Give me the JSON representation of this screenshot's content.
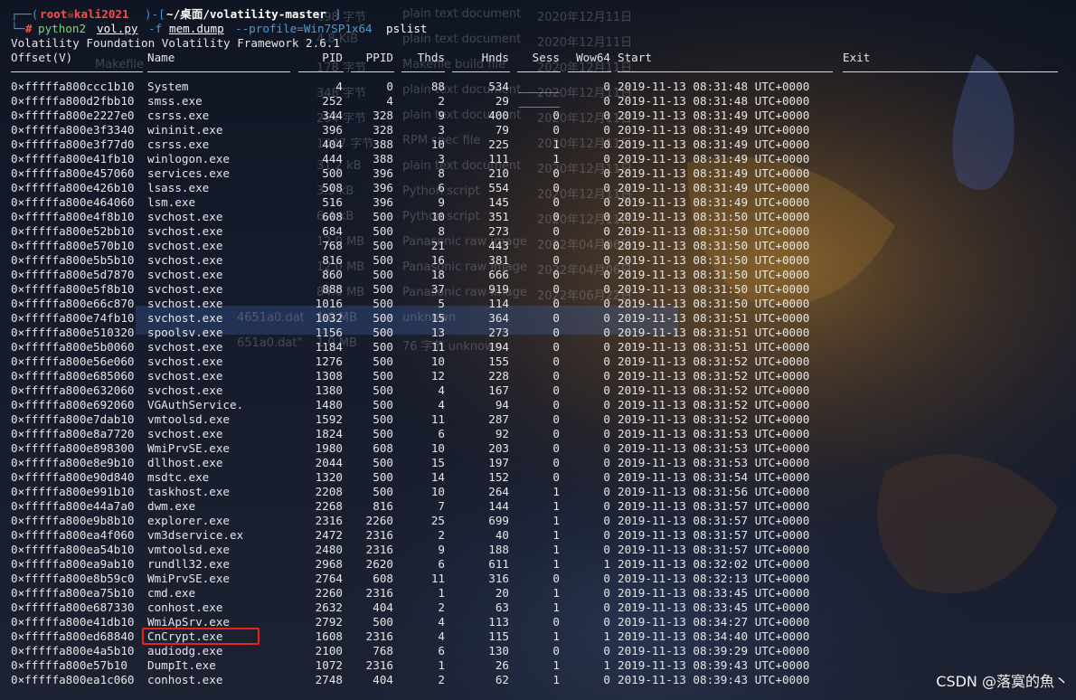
{
  "prompt": {
    "user_host": "root☠kali2021",
    "path": "~/桌面/volatility-master",
    "command": "python2",
    "script": "vol.py",
    "flag_f": "-f",
    "dump_file": "mem.dump",
    "profile_opt": "--profile=Win7SP1x64",
    "plugin": "pslist"
  },
  "banner": "Volatility Foundation Volatility Framework 2.6.1",
  "columns": [
    "Offset(V)",
    "Name",
    "PID",
    "PPID",
    "Thds",
    "Hnds",
    "Sess",
    "Wow64",
    "Start",
    "Exit"
  ],
  "processes": [
    [
      "0×fffffa800ccc1b10",
      "System",
      "4",
      "0",
      "88",
      "534",
      "______",
      "0",
      "2019-11-13 08:31:48 UTC+0000"
    ],
    [
      "0×fffffa800d2fbb10",
      "smss.exe",
      "252",
      "4",
      "2",
      "29",
      "______",
      "0",
      "2019-11-13 08:31:48 UTC+0000"
    ],
    [
      "0×fffffa800e2227e0",
      "csrss.exe",
      "344",
      "328",
      "9",
      "400",
      "0",
      "0",
      "2019-11-13 08:31:49 UTC+0000"
    ],
    [
      "0×fffffa800e3f3340",
      "wininit.exe",
      "396",
      "328",
      "3",
      "79",
      "0",
      "0",
      "2019-11-13 08:31:49 UTC+0000"
    ],
    [
      "0×fffffa800e3f77d0",
      "csrss.exe",
      "404",
      "388",
      "10",
      "225",
      "1",
      "0",
      "2019-11-13 08:31:49 UTC+0000"
    ],
    [
      "0×fffffa800e41fb10",
      "winlogon.exe",
      "444",
      "388",
      "3",
      "111",
      "1",
      "0",
      "2019-11-13 08:31:49 UTC+0000"
    ],
    [
      "0×fffffa800e457060",
      "services.exe",
      "500",
      "396",
      "8",
      "210",
      "0",
      "0",
      "2019-11-13 08:31:49 UTC+0000"
    ],
    [
      "0×fffffa800e426b10",
      "lsass.exe",
      "508",
      "396",
      "6",
      "554",
      "0",
      "0",
      "2019-11-13 08:31:49 UTC+0000"
    ],
    [
      "0×fffffa800e464060",
      "lsm.exe",
      "516",
      "396",
      "9",
      "145",
      "0",
      "0",
      "2019-11-13 08:31:49 UTC+0000"
    ],
    [
      "0×fffffa800e4f8b10",
      "svchost.exe",
      "608",
      "500",
      "10",
      "351",
      "0",
      "0",
      "2019-11-13 08:31:50 UTC+0000"
    ],
    [
      "0×fffffa800e52bb10",
      "svchost.exe",
      "684",
      "500",
      "8",
      "273",
      "0",
      "0",
      "2019-11-13 08:31:50 UTC+0000"
    ],
    [
      "0×fffffa800e570b10",
      "svchost.exe",
      "768",
      "500",
      "21",
      "443",
      "0",
      "0",
      "2019-11-13 08:31:50 UTC+0000"
    ],
    [
      "0×fffffa800e5b5b10",
      "svchost.exe",
      "816",
      "500",
      "16",
      "381",
      "0",
      "0",
      "2019-11-13 08:31:50 UTC+0000"
    ],
    [
      "0×fffffa800e5d7870",
      "svchost.exe",
      "860",
      "500",
      "18",
      "666",
      "0",
      "0",
      "2019-11-13 08:31:50 UTC+0000"
    ],
    [
      "0×fffffa800e5f8b10",
      "svchost.exe",
      "888",
      "500",
      "37",
      "919",
      "0",
      "0",
      "2019-11-13 08:31:50 UTC+0000"
    ],
    [
      "0×fffffa800e66c870",
      "svchost.exe",
      "1016",
      "500",
      "5",
      "114",
      "0",
      "0",
      "2019-11-13 08:31:50 UTC+0000"
    ],
    [
      "0×fffffa800e74fb10",
      "svchost.exe",
      "1032",
      "500",
      "15",
      "364",
      "0",
      "0",
      "2019-11-13 08:31:51 UTC+0000"
    ],
    [
      "0×fffffa800e510320",
      "spoolsv.exe",
      "1156",
      "500",
      "13",
      "273",
      "0",
      "0",
      "2019-11-13 08:31:51 UTC+0000"
    ],
    [
      "0×fffffa800e5b0060",
      "svchost.exe",
      "1184",
      "500",
      "11",
      "194",
      "0",
      "0",
      "2019-11-13 08:31:51 UTC+0000"
    ],
    [
      "0×fffffa800e56e060",
      "svchost.exe",
      "1276",
      "500",
      "10",
      "155",
      "0",
      "0",
      "2019-11-13 08:31:52 UTC+0000"
    ],
    [
      "0×fffffa800e685060",
      "svchost.exe",
      "1308",
      "500",
      "12",
      "228",
      "0",
      "0",
      "2019-11-13 08:31:52 UTC+0000"
    ],
    [
      "0×fffffa800e632060",
      "svchost.exe",
      "1380",
      "500",
      "4",
      "167",
      "0",
      "0",
      "2019-11-13 08:31:52 UTC+0000"
    ],
    [
      "0×fffffa800e692060",
      "VGAuthService.",
      "1480",
      "500",
      "4",
      "94",
      "0",
      "0",
      "2019-11-13 08:31:52 UTC+0000"
    ],
    [
      "0×fffffa800e7dab10",
      "vmtoolsd.exe",
      "1592",
      "500",
      "11",
      "287",
      "0",
      "0",
      "2019-11-13 08:31:52 UTC+0000"
    ],
    [
      "0×fffffa800e8a7720",
      "svchost.exe",
      "1824",
      "500",
      "6",
      "92",
      "0",
      "0",
      "2019-11-13 08:31:53 UTC+0000"
    ],
    [
      "0×fffffa800e898300",
      "WmiPrvSE.exe",
      "1980",
      "608",
      "10",
      "203",
      "0",
      "0",
      "2019-11-13 08:31:53 UTC+0000"
    ],
    [
      "0×fffffa800e8e9b10",
      "dllhost.exe",
      "2044",
      "500",
      "15",
      "197",
      "0",
      "0",
      "2019-11-13 08:31:53 UTC+0000"
    ],
    [
      "0×fffffa800e90d840",
      "msdtc.exe",
      "1320",
      "500",
      "14",
      "152",
      "0",
      "0",
      "2019-11-13 08:31:54 UTC+0000"
    ],
    [
      "0×fffffa800e991b10",
      "taskhost.exe",
      "2208",
      "500",
      "10",
      "264",
      "1",
      "0",
      "2019-11-13 08:31:56 UTC+0000"
    ],
    [
      "0×fffffa800e44a7a0",
      "dwm.exe",
      "2268",
      "816",
      "7",
      "144",
      "1",
      "0",
      "2019-11-13 08:31:57 UTC+0000"
    ],
    [
      "0×fffffa800e9b8b10",
      "explorer.exe",
      "2316",
      "2260",
      "25",
      "699",
      "1",
      "0",
      "2019-11-13 08:31:57 UTC+0000"
    ],
    [
      "0×fffffa800ea4f060",
      "vm3dservice.ex",
      "2472",
      "2316",
      "2",
      "40",
      "1",
      "0",
      "2019-11-13 08:31:57 UTC+0000"
    ],
    [
      "0×fffffa800ea54b10",
      "vmtoolsd.exe",
      "2480",
      "2316",
      "9",
      "188",
      "1",
      "0",
      "2019-11-13 08:31:57 UTC+0000"
    ],
    [
      "0×fffffa800ea9ab10",
      "rundll32.exe",
      "2968",
      "2620",
      "6",
      "611",
      "1",
      "1",
      "2019-11-13 08:32:02 UTC+0000"
    ],
    [
      "0×fffffa800e8b59c0",
      "WmiPrvSE.exe",
      "2764",
      "608",
      "11",
      "316",
      "0",
      "0",
      "2019-11-13 08:32:13 UTC+0000"
    ],
    [
      "0×fffffa800ea75b10",
      "cmd.exe",
      "2260",
      "2316",
      "1",
      "20",
      "1",
      "0",
      "2019-11-13 08:33:45 UTC+0000"
    ],
    [
      "0×fffffa800e687330",
      "conhost.exe",
      "2632",
      "404",
      "2",
      "63",
      "1",
      "0",
      "2019-11-13 08:33:45 UTC+0000"
    ],
    [
      "0×fffffa800e41db10",
      "WmiApSrv.exe",
      "2792",
      "500",
      "4",
      "113",
      "0",
      "0",
      "2019-11-13 08:34:27 UTC+0000"
    ],
    [
      "0×fffffa800ed68840",
      "CnCrypt.exe",
      "1608",
      "2316",
      "4",
      "115",
      "1",
      "1",
      "2019-11-13 08:34:40 UTC+0000"
    ],
    [
      "0×fffffa800e4a5b10",
      "audiodg.exe",
      "2100",
      "768",
      "6",
      "130",
      "0",
      "0",
      "2019-11-13 08:39:29 UTC+0000"
    ],
    [
      "0×fffffa800e57b10",
      "DumpIt.exe",
      "1072",
      "2316",
      "1",
      "26",
      "1",
      "1",
      "2019-11-13 08:39:43 UTC+0000"
    ],
    [
      "0×fffffa800ea1c060",
      "conhost.exe",
      "2748",
      "404",
      "2",
      "62",
      "1",
      "0",
      "2019-11-13 08:39:43 UTC+0000"
    ]
  ],
  "background_files": [
    {
      "size": "698 字节",
      "type": "plain text document",
      "date": "2020年12月11日"
    },
    {
      "size": "4.8 KiB",
      "type": "plain text document",
      "date": "2020年12月11日"
    },
    {
      "name": "Makefile",
      "size": "178 字节",
      "type": "Makefile build file",
      "date": "2020年12月11日"
    },
    {
      "size": "348 字节",
      "type": "plain text document",
      "date": "2020年12月11日"
    },
    {
      "size": "254 字节",
      "type": "plain text document",
      "date": "2020年12月11日"
    },
    {
      "size": "1007 字节",
      "type": "RPM spec file",
      "date": "2020年12月11日"
    },
    {
      "size": "31.2 kB",
      "type": "plain text document",
      "date": "2020年12月11日"
    },
    {
      "size": "3.5 kB",
      "type": "Python script",
      "date": "2020年12月11日"
    },
    {
      "size": "6.4 kB",
      "type": "Python script",
      "date": "2020年12月11日"
    },
    {
      "size": "12.0 MB",
      "type": "Panasonic raw image",
      "date": "2022年04月06日"
    },
    {
      "size": "12.0 MB",
      "type": "Panasonic raw image",
      "date": "2022年04月06日"
    },
    {
      "size": "84.0 MB",
      "type": "Panasonic raw image",
      "date": "2022年06月22日"
    },
    {
      "name": "4651a0.dat",
      "size": "1.0 MB",
      "type": "unknown"
    },
    {
      "name": "651a0.dat\"",
      "size": "1.0 MB",
      "type": "76 字节 unknown"
    }
  ],
  "watermark": "CSDN @落寞的魚丶",
  "colors": {
    "highlight_box": "#e8231f",
    "prompt": "#4e8cd6",
    "user": "#ff4d4d",
    "command": "#7fd67f",
    "option": "#4e9ad8"
  }
}
